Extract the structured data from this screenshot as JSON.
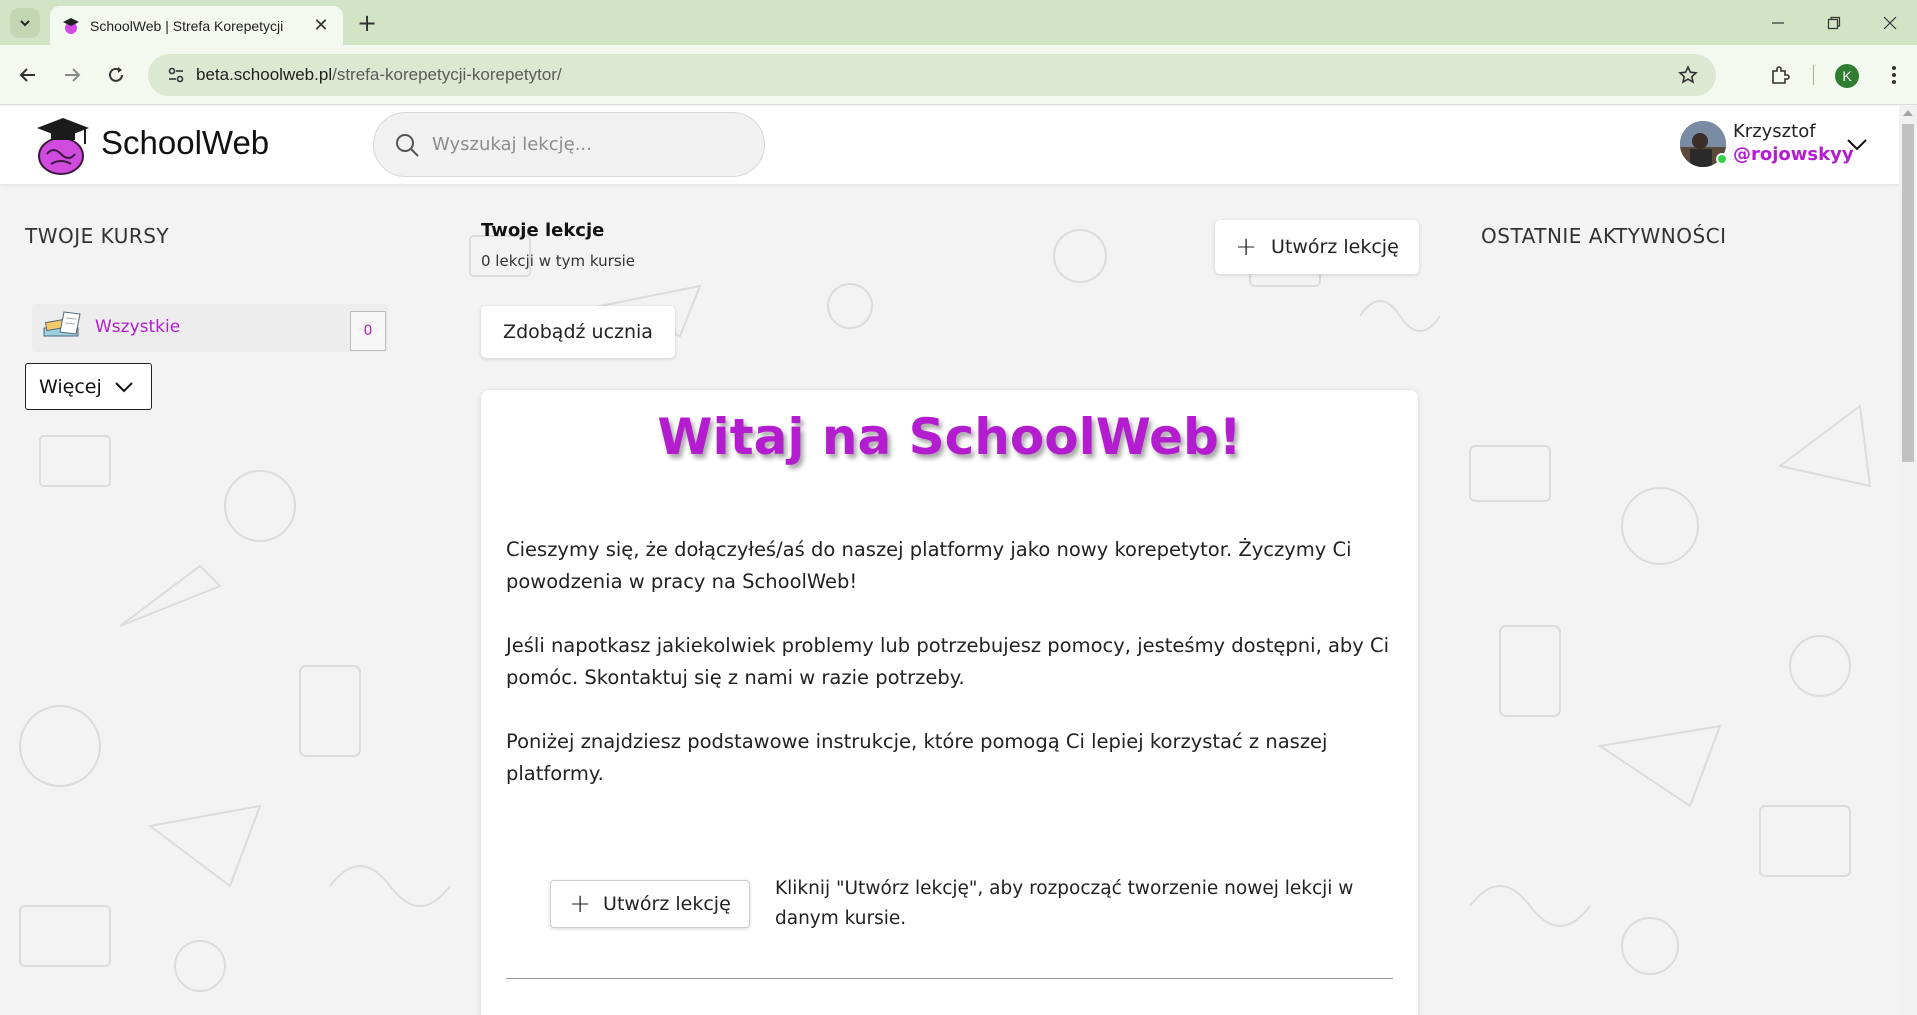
{
  "browser": {
    "tab_title": "SchoolWeb | Strefa Korepetycji",
    "url_host": "beta.schoolweb.pl",
    "url_path": "/strefa-korepetycji-korepetytor/",
    "profile_initial": "K",
    "accent_color": "#d3e3c5"
  },
  "header": {
    "brand": "SchoolWeb",
    "search_placeholder": "Wyszukaj lekcję...",
    "user": {
      "name": "Krzysztof",
      "handle": "@rojowskyy",
      "online": true
    }
  },
  "left": {
    "title": "TWOJE KURSY",
    "courses": [
      {
        "label": "Wszystkie",
        "count": "0"
      }
    ],
    "more_label": "Więcej"
  },
  "center": {
    "title": "Twoje lekcje",
    "subtitle": "0 lekcji w tym kursie",
    "create_label": "Utwórz lekcję",
    "get_student_label": "Zdobądź ucznia",
    "welcome": {
      "title": "Witaj na SchoolWeb!",
      "p1": "Cieszymy się, że dołączyłeś/aś do naszej platformy jako nowy korepetytor. Życzymy Ci powodzenia w pracy na SchoolWeb!",
      "p2": "Jeśli napotkasz jakiekolwiek problemy lub potrzebujesz pomocy, jesteśmy dostępni, aby Ci pomóc. Skontaktuj się z nami w razie potrzeby.",
      "p3": "Poniżej znajdziesz podstawowe instrukcje, które pomogą Ci lepiej korzystać z naszej platformy.",
      "create_label": "Utwórz lekcję",
      "create_hint": "Kliknij \"Utwórz lekcję\", aby rozpocząć tworzenie nowej lekcji w danym kursie."
    }
  },
  "right": {
    "title": "OSTATNIE AKTYWNOŚCI"
  },
  "colors": {
    "brand_purple": "#b41cd0",
    "online_green": "#35d14a"
  }
}
